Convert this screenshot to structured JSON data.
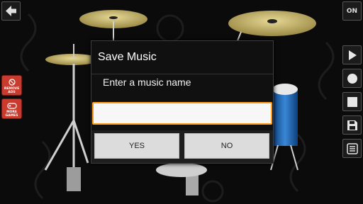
{
  "toolbar": {
    "on_label": "ON",
    "back_icon": "arrow-left-icon"
  },
  "side_buttons": [
    {
      "icon": "play-icon"
    },
    {
      "icon": "record-icon"
    },
    {
      "icon": "stop-icon"
    },
    {
      "icon": "save-icon"
    },
    {
      "icon": "list-icon"
    }
  ],
  "left_buttons": {
    "remove_ads": "REMOVE ADS",
    "more_games": "MORE GAMES"
  },
  "dialog": {
    "title": "Save Music",
    "message": "Enter a music name",
    "input_value": "",
    "yes_label": "YES",
    "no_label": "NO"
  },
  "colors": {
    "accent_orange": "#ff9c1a",
    "ad_button_red": "#c93b2d",
    "cymbal_gold": "#c9b96a",
    "drum_blue": "#1e57a5"
  }
}
